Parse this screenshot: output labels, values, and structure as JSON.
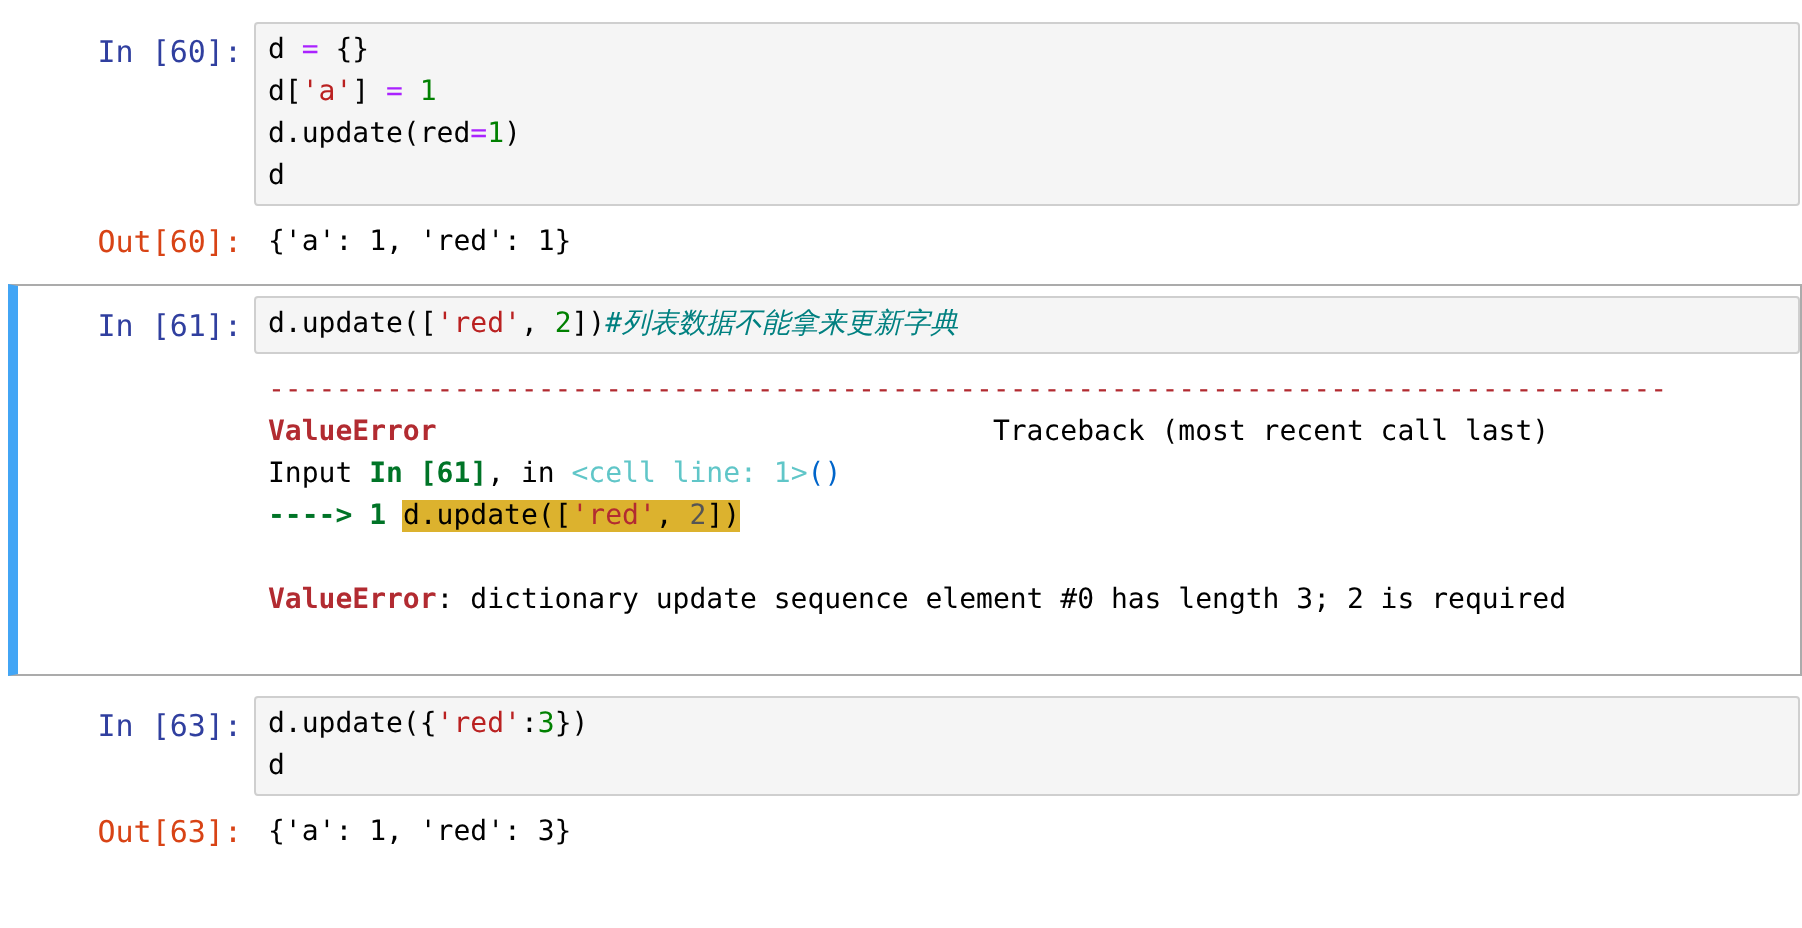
{
  "cells": [
    {
      "prompt": "In [60]:",
      "selected": false,
      "code": [
        [
          {
            "kind": "name",
            "text": "d "
          },
          {
            "kind": "op",
            "text": "="
          },
          {
            "kind": "name",
            "text": " {}"
          }
        ],
        [
          {
            "kind": "name",
            "text": "d["
          },
          {
            "kind": "string",
            "text": "'a'"
          },
          {
            "kind": "name",
            "text": "] "
          },
          {
            "kind": "op",
            "text": "= "
          },
          {
            "kind": "number",
            "text": "1"
          }
        ],
        [
          {
            "kind": "name",
            "text": "d.update(red"
          },
          {
            "kind": "op",
            "text": "="
          },
          {
            "kind": "number",
            "text": "1"
          },
          {
            "kind": "name",
            "text": ")"
          }
        ],
        [
          {
            "kind": "name",
            "text": "d"
          }
        ]
      ],
      "output_prompt": "Out[60]:",
      "output_blocks": [
        [
          [
            {
              "kind": "name",
              "text": "{'a': 1, 'red': 1}"
            }
          ]
        ]
      ]
    },
    {
      "prompt": "In [61]:",
      "selected": true,
      "code": [
        [
          {
            "kind": "name",
            "text": "d.update(["
          },
          {
            "kind": "string",
            "text": "'red'"
          },
          {
            "kind": "name",
            "text": ", "
          },
          {
            "kind": "number",
            "text": "2"
          },
          {
            "kind": "name",
            "text": "])"
          },
          {
            "kind": "comment",
            "text": "#列表数据不能拿来更新字典"
          }
        ]
      ],
      "output_blocks": [
        [
          [
            {
              "kind": "error",
              "text": "-----------------------------------------------------------------------------------"
            }
          ],
          [
            {
              "kind": "error-bold",
              "text": "ValueError"
            },
            {
              "kind": "name",
              "text": "                                 Traceback (most recent call last)"
            }
          ],
          [
            {
              "kind": "name",
              "text": "Input "
            },
            {
              "kind": "green-bold",
              "text": "In [61]"
            },
            {
              "kind": "name",
              "text": ", in "
            },
            {
              "kind": "cyan",
              "text": "<cell line: 1>"
            },
            {
              "kind": "blue",
              "text": "()"
            }
          ],
          [
            {
              "kind": "green-bold",
              "text": "----> 1 "
            },
            {
              "kind": "highlight",
              "text": "d.update(["
            },
            {
              "kind": "highlight-string",
              "text": "'red'"
            },
            {
              "kind": "highlight",
              "text": ", "
            },
            {
              "kind": "highlight-number",
              "text": "2"
            },
            {
              "kind": "highlight",
              "text": "])"
            }
          ]
        ],
        [
          [
            {
              "kind": "error-bold",
              "text": "ValueError"
            },
            {
              "kind": "name",
              "text": ": dictionary update sequence element #0 has length 3; 2 is required"
            }
          ]
        ]
      ]
    },
    {
      "prompt": "In [63]:",
      "selected": false,
      "code": [
        [
          {
            "kind": "name",
            "text": "d.update({"
          },
          {
            "kind": "string",
            "text": "'red'"
          },
          {
            "kind": "name",
            "text": ":"
          },
          {
            "kind": "number",
            "text": "3"
          },
          {
            "kind": "name",
            "text": "})"
          }
        ],
        [
          {
            "kind": "name",
            "text": "d"
          }
        ]
      ],
      "output_prompt": "Out[63]:",
      "output_blocks": [
        [
          [
            {
              "kind": "name",
              "text": "{'a': 1, 'red': 3}"
            }
          ]
        ]
      ]
    }
  ]
}
